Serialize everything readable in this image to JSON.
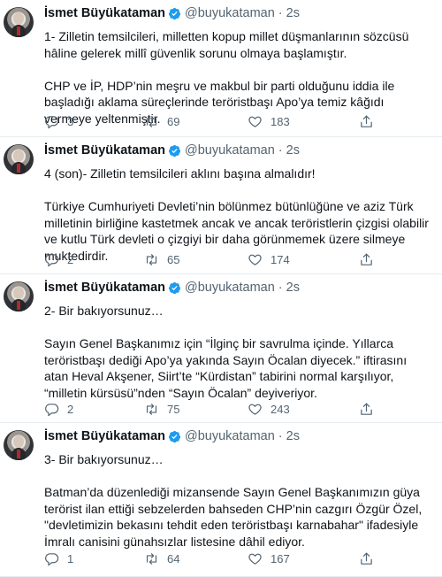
{
  "tweets": [
    {
      "name": "İsmet Büyükataman",
      "handle": "@buyukataman",
      "separator": "·",
      "time": "2s",
      "paragraphs": [
        "1- Zilletin temsilcileri, milletten kopup millet düşmanlarının sözcüsü hâline gelerek millî güvenlik sorunu olmaya başlamıştır.",
        "CHP ve İP, HDP’nin meşru ve makbul bir parti olduğunu iddia ile başladığı aklama süreçlerinde teröristbaşı Apo’ya temiz kâğıdı vermeye yeltenmiştir."
      ],
      "replies": "3",
      "retweets": "69",
      "likes": "183"
    },
    {
      "name": "İsmet Büyükataman",
      "handle": "@buyukataman",
      "separator": "·",
      "time": "2s",
      "paragraphs": [
        "4 (son)- Zilletin temsilcileri aklını başına almalıdır!",
        "Türkiye Cumhuriyeti Devleti’nin bölünmez bütünlüğüne ve aziz Türk milletinin birliğine kastetmek ancak ve ancak teröristlerin çizgisi olabilir ve kutlu Türk devleti o çizgiyi bir daha görünmemek üzere silmeye muktedirdir."
      ],
      "replies": "2",
      "retweets": "65",
      "likes": "174"
    },
    {
      "name": "İsmet Büyükataman",
      "handle": "@buyukataman",
      "separator": "·",
      "time": "2s",
      "paragraphs": [
        "2- Bir bakıyorsunuz…",
        "Sayın Genel Başkanımız için “İlginç bir savrulma içinde. Yıllarca teröristbaşı dediği Apo’ya yakında Sayın Öcalan diyecek.” iftirasını atan Heval Akşener, Siirt’te “Kürdistan” tabirini normal karşılıyor, “milletin kürsüsü”nden “Sayın Öcalan” deyiveriyor."
      ],
      "replies": "2",
      "retweets": "75",
      "likes": "243"
    },
    {
      "name": "İsmet Büyükataman",
      "handle": "@buyukataman",
      "separator": "·",
      "time": "2s",
      "paragraphs": [
        "3- Bir bakıyorsunuz…",
        "Batman’da düzenlediği mizansende Sayın Genel Başkanımızın güya terörist ilan ettiği sebzelerden bahseden CHP’nin cazgırı Özgür Özel, \"devletimizin bekasını tehdit eden teröristbaşı karnabahar\" ifadesiyle İmralı canisini günahsızlar listesine dâhil ediyor."
      ],
      "replies": "1",
      "retweets": "64",
      "likes": "167"
    }
  ],
  "icons": {
    "verified": "verified-badge-icon",
    "reply": "reply-icon",
    "retweet": "retweet-icon",
    "like": "heart-icon",
    "share": "share-icon"
  },
  "colors": {
    "verified": "#1d9bf0",
    "secondary_text": "#536471",
    "divider": "#e6ecf0"
  }
}
